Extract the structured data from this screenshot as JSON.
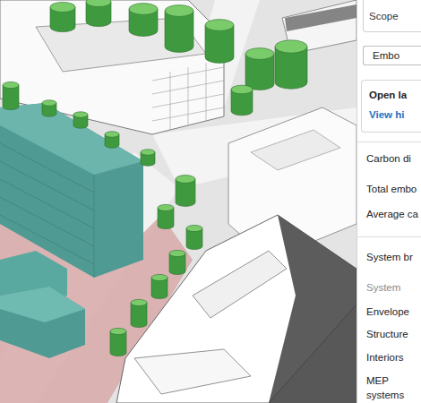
{
  "panel": {
    "scope_label": "Scope",
    "embodied_button": "Embo",
    "open_card": {
      "title": "Open la",
      "link": "View hi"
    },
    "carbon_section": {
      "title": "Carbon di",
      "rows": [
        "Total embo",
        "Average ca"
      ]
    },
    "system_section": {
      "title": "System br",
      "column_header": "System",
      "systems": [
        "Envelope",
        "Structure",
        "Interiors",
        "MEP systems"
      ]
    }
  }
}
